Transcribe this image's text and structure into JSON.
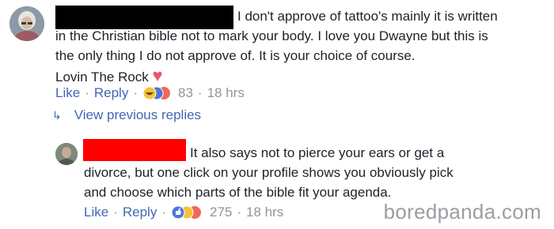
{
  "comment": {
    "text_lines": [
      "I don't approve of tattoo's mainly it is written",
      "in the Christian bible not to mark your body. I love you Dwayne but this is",
      "the only thing I do not approve of. It is your choice of course.",
      "Lovin The Rock"
    ],
    "heart": "♥",
    "like_label": "Like",
    "reply_label": "Reply",
    "reaction_count": "83",
    "time": "18 hrs"
  },
  "view_previous_replies": {
    "arrow": "↳",
    "label": "View previous replies"
  },
  "reply": {
    "text_lines": [
      "It also says not to pierce your ears or get a",
      "divorce, but one click on your profile shows you obviously pick",
      "and choose which parts of the bible fit your agenda."
    ],
    "like_label": "Like",
    "reply_label": "Reply",
    "reaction_count": "275",
    "time": "18 hrs"
  },
  "watermark": "boredpanda.com",
  "colors": {
    "link": "#4267b2",
    "meta": "#90949c",
    "text": "#1d2129",
    "heart": "#e7566c",
    "redaction_top": "#000000",
    "redaction_reply": "#ff0000"
  }
}
